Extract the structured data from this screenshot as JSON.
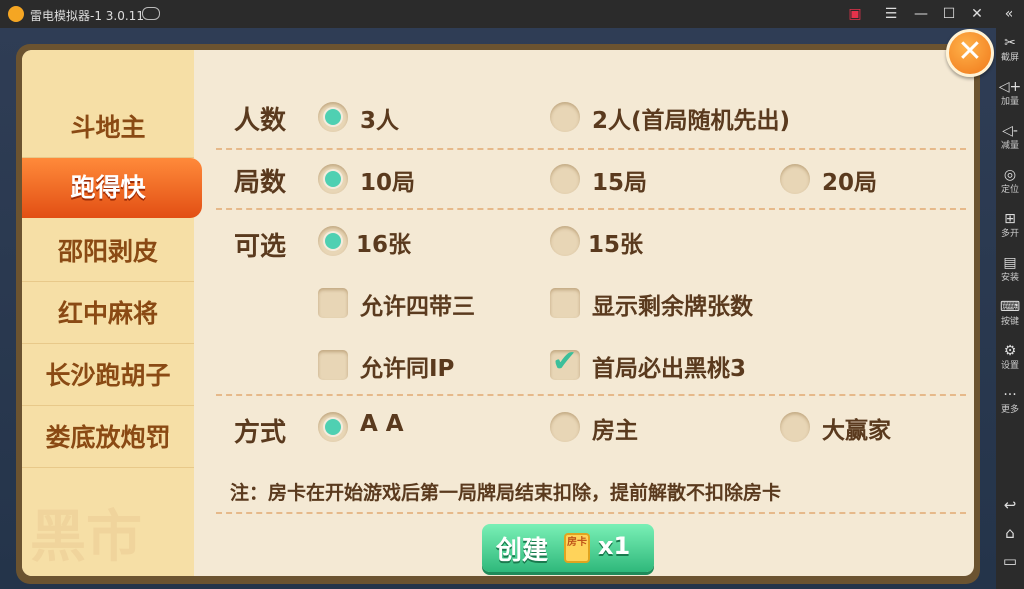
{
  "titlebar": {
    "title": "雷电模拟器-1 3.0.11",
    "buttons": [
      "gift-icon",
      "menu-icon",
      "minimize-icon",
      "maximize-icon",
      "close-icon"
    ]
  },
  "sidebar": {
    "items": [
      {
        "icon": "scissors-icon",
        "label": "截屏"
      },
      {
        "icon": "volume-up-icon",
        "label": "加量"
      },
      {
        "icon": "volume-down-icon",
        "label": "减量"
      },
      {
        "icon": "location-icon",
        "label": "定位"
      },
      {
        "icon": "multi-open-icon",
        "label": "多开"
      },
      {
        "icon": "apk-install-icon",
        "label": "安装"
      },
      {
        "icon": "keyboard-icon",
        "label": "按键"
      },
      {
        "icon": "settings-icon",
        "label": "设置"
      },
      {
        "icon": "more-icon",
        "label": "更多"
      }
    ],
    "nav": [
      "back-icon",
      "home-icon",
      "recent-apps-icon"
    ]
  },
  "tabs": [
    {
      "label": "斗地主",
      "active": false
    },
    {
      "label": "跑得快",
      "active": true
    },
    {
      "label": "邵阳剥皮",
      "active": false
    },
    {
      "label": "红中麻将",
      "active": false
    },
    {
      "label": "长沙跑胡子",
      "active": false
    },
    {
      "label": "娄底放炮罚",
      "active": false
    }
  ],
  "watermark": "黑市",
  "rows": {
    "players": {
      "label": "人数",
      "options": [
        {
          "label": "3人",
          "selected": true
        },
        {
          "label": "2人(首局随机先出)",
          "selected": false
        }
      ]
    },
    "rounds": {
      "label": "局数",
      "options": [
        {
          "label": "10局",
          "selected": true
        },
        {
          "label": "15局",
          "selected": false
        },
        {
          "label": "20局",
          "selected": false
        }
      ]
    },
    "optional": {
      "label": "可选",
      "radios": [
        {
          "label": "16张",
          "selected": true
        },
        {
          "label": "15张",
          "selected": false
        }
      ],
      "checkboxes": [
        {
          "label": "允许四带三",
          "checked": false
        },
        {
          "label": "显示剩余牌张数",
          "checked": false
        },
        {
          "label": "允许同IP",
          "checked": false
        },
        {
          "label": "首局必出黑桃3",
          "checked": true
        }
      ]
    },
    "payment": {
      "label": "方式",
      "options": [
        {
          "label": "A A",
          "selected": true
        },
        {
          "label": "房主",
          "selected": false
        },
        {
          "label": "大赢家",
          "selected": false
        }
      ]
    }
  },
  "note": "注：房卡在开始游戏后第一局牌局结束扣除，提前解散不扣除房卡",
  "create_button": {
    "label": "创建",
    "card_text": "房卡",
    "count": "x1"
  },
  "colors": {
    "accent": "#e24f14",
    "selected_dot": "#4fd0b2",
    "create": "#2fb87b"
  }
}
